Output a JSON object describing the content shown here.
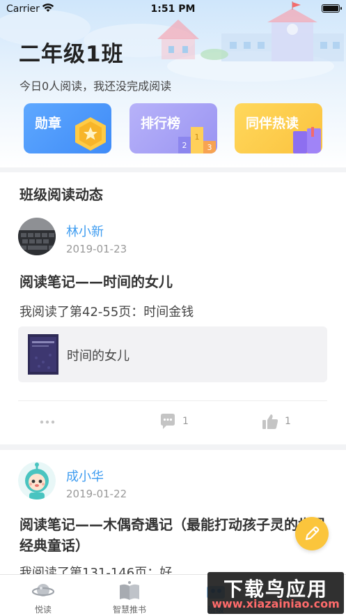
{
  "status_bar": {
    "carrier": "Carrier",
    "time": "1:51 PM"
  },
  "header": {
    "class_title": "二年级1班",
    "reading_summary": "今日0人阅读，我还没完成阅读",
    "tiles": [
      {
        "label": "勋章",
        "icon": "medal-icon",
        "color": "#4a97fa"
      },
      {
        "label": "排行榜",
        "icon": "podium-icon",
        "color": "#a7a1f5"
      },
      {
        "label": "同伴热读",
        "icon": "books-icon",
        "color": "#fbc94a"
      }
    ]
  },
  "feed": {
    "section_title": "班级阅读动态",
    "posts": [
      {
        "user": "林小新",
        "date": "2019-01-23",
        "title": "阅读笔记——时间的女儿",
        "excerpt": "我阅读了第42-55页：时间金钱",
        "book_title": "时间的女儿",
        "comments": "1",
        "likes": "1"
      },
      {
        "user": "成小华",
        "date": "2019-01-22",
        "title": "阅读笔记——木偶奇遇记（最能打动孩子灵的世界经典童话）",
        "excerpt": "我阅读了第131-146页：好"
      }
    ]
  },
  "tabbar": {
    "tabs": [
      {
        "label": "悦读",
        "icon": "planet-icon"
      },
      {
        "label": "智慧推书",
        "icon": "book-icon"
      },
      {
        "label": "班级",
        "icon": "class-icon",
        "active": true
      }
    ]
  },
  "watermark": {
    "main": "下载鸟应用",
    "sub": "www.xiazainiao.com"
  },
  "colors": {
    "accent": "#3e9cf0",
    "fab": "#fbc53c"
  }
}
